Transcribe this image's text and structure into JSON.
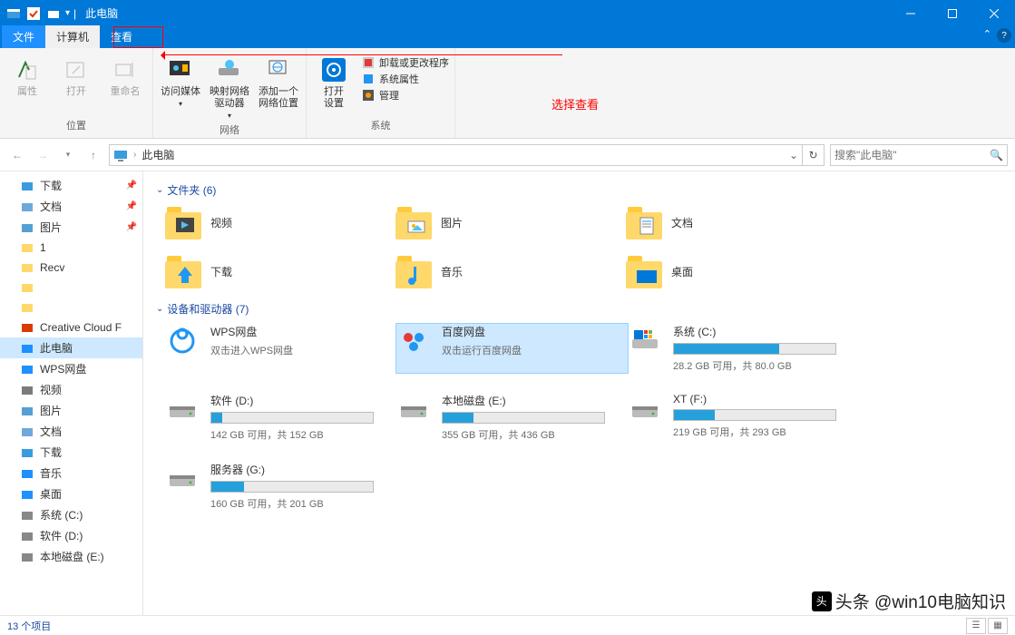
{
  "title": "此电脑",
  "tabs": {
    "file": "文件",
    "computer": "计算机",
    "view": "查看"
  },
  "ribbon": {
    "location": {
      "group": "位置",
      "properties": "属性",
      "open": "打开",
      "rename": "重命名"
    },
    "network": {
      "group": "网络",
      "media": "访问媒体",
      "mapdrive": "映射网络\n驱动器",
      "addloc": "添加一个\n网络位置"
    },
    "system": {
      "group": "系统",
      "settings": "打开\n设置",
      "uninstall": "卸载或更改程序",
      "sysprops": "系统属性",
      "manage": "管理"
    }
  },
  "nav": {
    "location": "此电脑",
    "search_placeholder": "搜索\"此电脑\""
  },
  "sidebar": [
    {
      "name": "downloads",
      "label": "下载",
      "color": "#3a9bde",
      "pin": true
    },
    {
      "name": "documents",
      "label": "文档",
      "color": "#6fa8dc",
      "pin": true
    },
    {
      "name": "pictures",
      "label": "图片",
      "color": "#56a0d3",
      "pin": true
    },
    {
      "name": "folder1",
      "label": "1",
      "color": "#ffd86b"
    },
    {
      "name": "folder2",
      "label": "Recv",
      "color": "#ffd86b"
    },
    {
      "name": "folder3",
      "label": "",
      "color": "#ffd86b"
    },
    {
      "name": "folder4",
      "label": "",
      "color": "#ffd86b"
    },
    {
      "name": "creative",
      "label": "Creative Cloud F",
      "color": "#da3b01"
    },
    {
      "name": "thispc",
      "label": "此电脑",
      "color": "#1e90ff",
      "sel": true
    },
    {
      "name": "wps",
      "label": "WPS网盘",
      "color": "#1e90ff"
    },
    {
      "name": "videos",
      "label": "视频",
      "color": "#7b7b7b"
    },
    {
      "name": "pictures2",
      "label": "图片",
      "color": "#56a0d3"
    },
    {
      "name": "documents2",
      "label": "文档",
      "color": "#6fa8dc"
    },
    {
      "name": "downloads2",
      "label": "下载",
      "color": "#3a9bde"
    },
    {
      "name": "music",
      "label": "音乐",
      "color": "#1e90ff"
    },
    {
      "name": "desktop",
      "label": "桌面",
      "color": "#1e90ff"
    },
    {
      "name": "drivec",
      "label": "系统 (C:)",
      "color": "#888"
    },
    {
      "name": "drived",
      "label": "软件 (D:)",
      "color": "#888"
    },
    {
      "name": "drivee",
      "label": "本地磁盘 (E:)",
      "color": "#888"
    }
  ],
  "groups": {
    "folders": "文件夹 (6)",
    "drives": "设备和驱动器 (7)"
  },
  "folders": [
    {
      "key": "videos",
      "label": "视频"
    },
    {
      "key": "pictures",
      "label": "图片"
    },
    {
      "key": "documents",
      "label": "文档"
    },
    {
      "key": "downloads",
      "label": "下载"
    },
    {
      "key": "music",
      "label": "音乐"
    },
    {
      "key": "desktop",
      "label": "桌面"
    }
  ],
  "drives": [
    {
      "key": "wps",
      "name": "WPS网盘",
      "sub": "双击进入WPS网盘",
      "bar": null
    },
    {
      "key": "baidu",
      "name": "百度网盘",
      "sub": "双击运行百度网盘",
      "bar": null,
      "sel": true
    },
    {
      "key": "c",
      "name": "系统 (C:)",
      "sub": "28.2 GB 可用，共 80.0 GB",
      "bar": 65
    },
    {
      "key": "d",
      "name": "软件 (D:)",
      "sub": "142 GB 可用，共 152 GB",
      "bar": 7
    },
    {
      "key": "e",
      "name": "本地磁盘 (E:)",
      "sub": "355 GB 可用，共 436 GB",
      "bar": 19
    },
    {
      "key": "f",
      "name": "XT (F:)",
      "sub": "219 GB 可用，共 293 GB",
      "bar": 25
    },
    {
      "key": "g",
      "name": "服务器 (G:)",
      "sub": "160 GB 可用，共 201 GB",
      "bar": 20
    }
  ],
  "status": "13 个项目",
  "annotation": "选择查看",
  "watermark": "头条 @win10电脑知识"
}
